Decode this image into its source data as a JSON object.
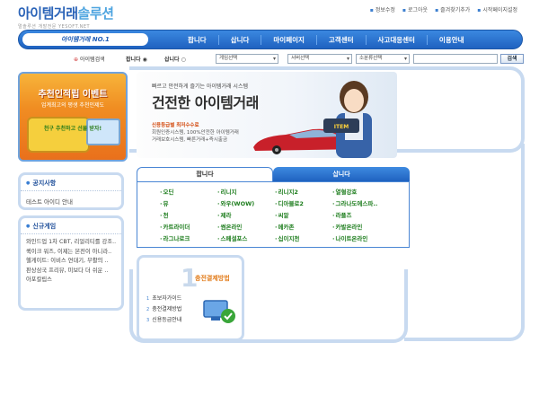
{
  "header": {
    "logo_main_a": "아이템거래",
    "logo_main_b": "솔루션",
    "logo_sub": "멀솔루션 개발전문  YESOFT.NET",
    "top_links": [
      "정보수정",
      "로그아웃",
      "즐겨찾기추가",
      "시작페이지설정"
    ]
  },
  "nav": {
    "brand": "아이템거래 NO.1",
    "items": [
      "팝니다",
      "삽니다",
      "마이페이지",
      "고객센터",
      "사고대응센터",
      "이용안내"
    ]
  },
  "search": {
    "label": "아이템검색",
    "radio_sell": "팝니다",
    "radio_buy": "삽니다",
    "select_game": "게임선택",
    "select_server": "서버선택",
    "select_type": "소분류선택",
    "button": "검색"
  },
  "event_banner": {
    "title": "추천인적립 이벤트",
    "sub": "업계최고의 평생 추천인제도",
    "gift_text": "천구 추천하고 선물 받자!"
  },
  "main_banner": {
    "tagline": "빠르고 안전하게 즐기는 아이템거래 시스템",
    "title": "건전한 아이템거래",
    "line1": "신용등급별 최저수수료",
    "line2": "회원인증시스템, 100%안전한 아이템거래",
    "line3": "거래보호시스템, 빠른거래+즉시출금"
  },
  "tabs": {
    "sell": "팝니다",
    "buy": "삽니다"
  },
  "games": [
    "오딘",
    "리니지",
    "리니지2",
    "열혈강호",
    "뮤",
    "와우(WOW)",
    "디아블로2",
    "그라나도에스파..",
    "천",
    "제라",
    "씨알",
    "라플즈",
    "카트라이더",
    "썸온라인",
    "메카존",
    "카발온라인",
    "라그나로크",
    "스페셜포스",
    "십이지천",
    "나이트온라인"
  ],
  "notice": {
    "title": "공지사항",
    "items": [
      "테스트 아이디 안내"
    ]
  },
  "new_games": {
    "title": "신규게임",
    "items": [
      "와인드업 1차 CBT, 리얼리티를 강조..",
      "퀵이크 워즈, 이제는 본전이 아니라..",
      "헬게이트: 이비스 연대기, 부활의 ..",
      "판상삼국 프리뷰, 미보다 더 쉬운 ..",
      "아포칼립스"
    ]
  },
  "payment": {
    "number": "1",
    "title": "충전결제방법",
    "items": [
      {
        "num": "1",
        "label": "초보자가이드"
      },
      {
        "num": "2",
        "label": "충전결제방법"
      },
      {
        "num": "3",
        "label": "신용등급안내"
      }
    ]
  }
}
